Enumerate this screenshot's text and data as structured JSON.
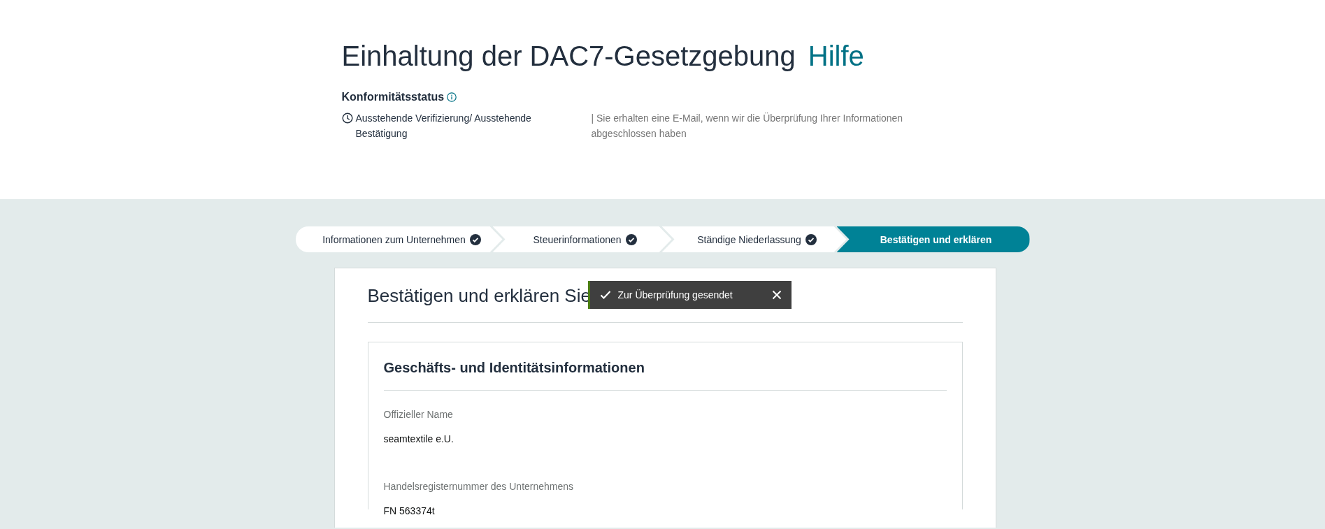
{
  "header": {
    "title": "Einhaltung der DAC7-Gesetzgebung",
    "help_link": "Hilfe",
    "status_label": "Konformitätsstatus",
    "status_text": "Ausstehende Verifizierung/ Ausstehende Bestätigung",
    "status_note": "| Sie erhalten eine E-Mail, wenn wir die Überprüfung Ihrer Informationen abgeschlossen haben"
  },
  "steps": [
    {
      "label": "Informationen zum Unternehmen",
      "completed": true,
      "selected": false
    },
    {
      "label": "Steuerinformationen",
      "completed": true,
      "selected": false
    },
    {
      "label": "Ständige Niederlassung",
      "completed": true,
      "selected": false
    },
    {
      "label": "Bestätigen und erklären",
      "completed": false,
      "selected": true
    }
  ],
  "main": {
    "heading": "Bestätigen und erklären Sie",
    "toast": {
      "text": "Zur Überprüfung gesendet"
    },
    "section": {
      "title": "Geschäfts- und Identitätsinformationen",
      "fields": [
        {
          "label": "Offizieller Name",
          "value": "seamtextile e.U."
        },
        {
          "label": "Handelsregisternummer des Unternehmens",
          "value": "FN 563374t"
        }
      ]
    }
  }
}
